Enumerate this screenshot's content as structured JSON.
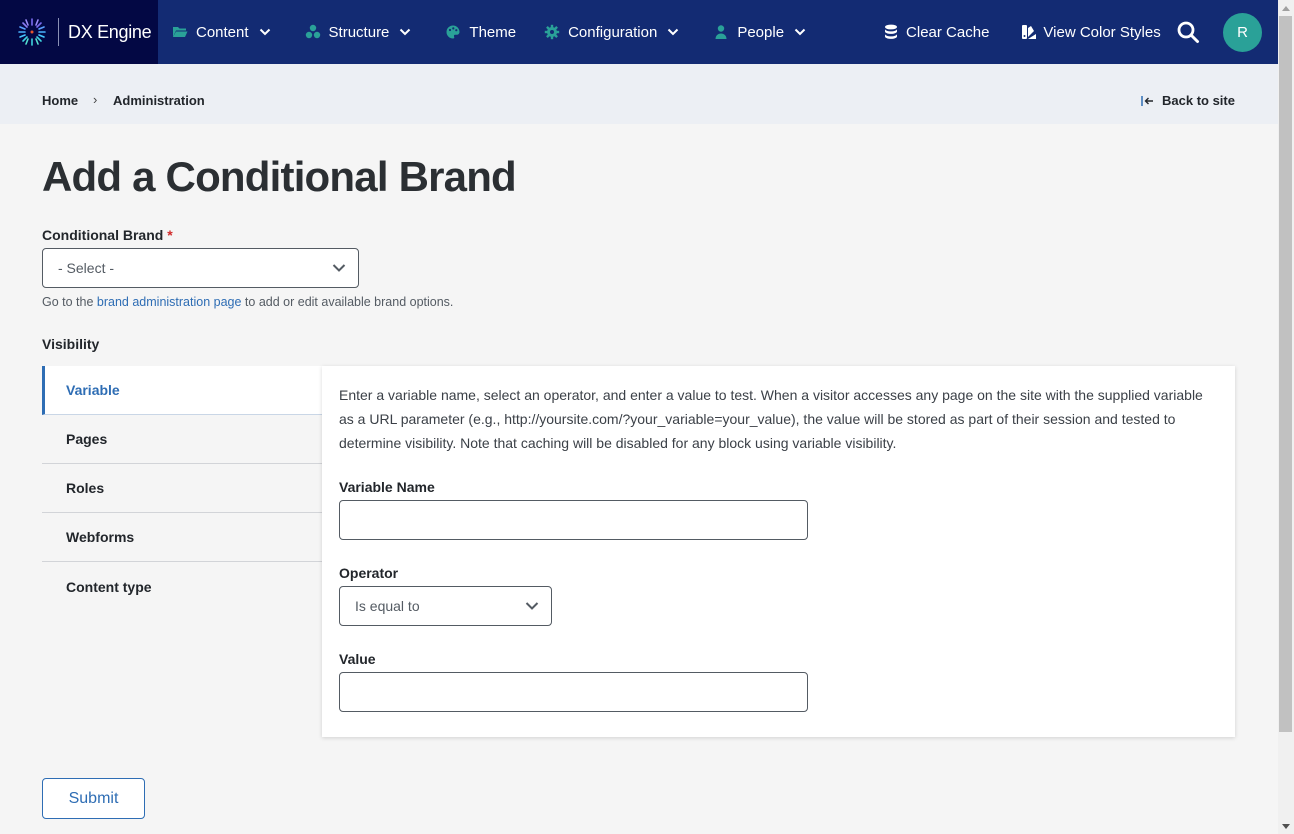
{
  "app": {
    "name": "DX Engine"
  },
  "nav": {
    "items": [
      {
        "label": "Content",
        "icon": "folder-icon",
        "has_dropdown": true
      },
      {
        "label": "Structure",
        "icon": "structure-icon",
        "has_dropdown": true
      },
      {
        "label": "Theme",
        "icon": "palette-icon",
        "has_dropdown": false
      },
      {
        "label": "Configuration",
        "icon": "gear-icon",
        "has_dropdown": true
      },
      {
        "label": "People",
        "icon": "person-icon",
        "has_dropdown": true
      }
    ],
    "actions": [
      {
        "label": "Clear Cache",
        "icon": "database-icon"
      },
      {
        "label": "View Color Styles",
        "icon": "color-swatch-icon"
      }
    ],
    "avatar_initial": "R",
    "accent": "#2aa198"
  },
  "breadcrumb": {
    "items": [
      "Home",
      "Administration"
    ],
    "separator": "›",
    "back_label": "Back to site"
  },
  "page": {
    "title": "Add a Conditional Brand"
  },
  "form": {
    "brand_label": "Conditional Brand",
    "brand_required_mark": "*",
    "brand_select_value": "- Select -",
    "help_prefix": "Go to the ",
    "help_link": "brand administration page",
    "help_suffix": " to add or edit available brand options.",
    "visibility_label": "Visibility",
    "tabs": [
      {
        "label": "Variable",
        "active": true
      },
      {
        "label": "Pages",
        "active": false
      },
      {
        "label": "Roles",
        "active": false
      },
      {
        "label": "Webforms",
        "active": false
      },
      {
        "label": "Content type",
        "active": false
      }
    ],
    "variable_panel": {
      "description": "Enter a variable name, select an operator, and enter a value to test. When a visitor accesses any page on the site with the supplied variable as a URL parameter (e.g., http://yoursite.com/?your_variable=your_value), the value will be stored as part of their session and tested to determine visibility. Note that caching will be disabled for any block using variable visibility.",
      "variable_name_label": "Variable Name",
      "variable_name_value": "",
      "operator_label": "Operator",
      "operator_value": "Is equal to",
      "value_label": "Value",
      "value_value": ""
    },
    "submit_label": "Submit"
  },
  "colors": {
    "nav_bg": "#132b73",
    "brand_bg": "#030844",
    "link": "#2e6db4",
    "required": "#d12a2a"
  }
}
